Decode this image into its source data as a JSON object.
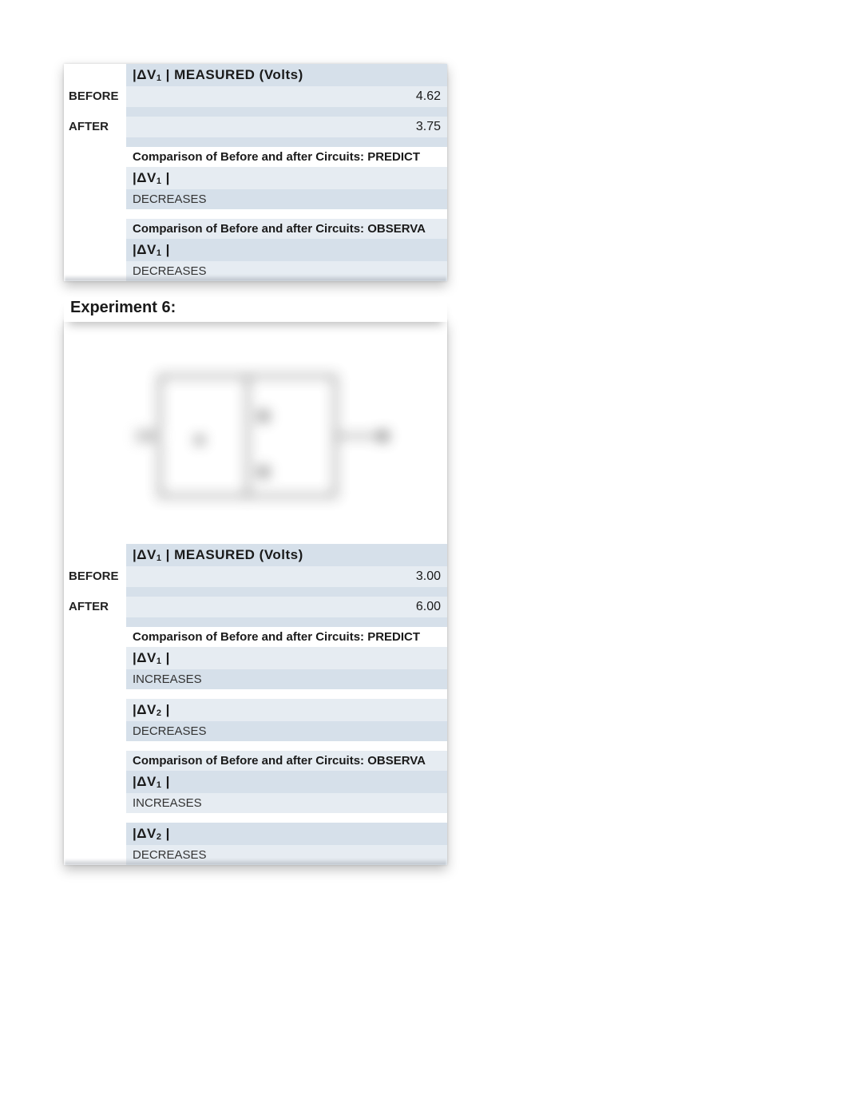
{
  "panel1": {
    "header": {
      "dv": "|ΔV",
      "sub": "1",
      "rest": " | MEASURED (Volts)"
    },
    "before_label": "BEFORE",
    "before_value": "4.62",
    "after_label": "AFTER",
    "after_value": "3.75",
    "predict_title": "Comparison of Before and after Circuits:  PREDICT",
    "predict_dv": "|ΔV",
    "predict_sub": "1",
    "predict_rest": " |",
    "predict_value": "DECREASES",
    "observa_title": "Comparison of Before and after Circuits:  OBSERVA",
    "observa_dv": "|ΔV",
    "observa_sub": "1",
    "observa_rest": " |",
    "observa_value": "DECREASES"
  },
  "experiment_title": "Experiment 6:",
  "panel2": {
    "header": {
      "dv": "|ΔV",
      "sub": "1",
      "rest": " | MEASURED (Volts)"
    },
    "before_label": "BEFORE",
    "before_value": "3.00",
    "after_label": "AFTER",
    "after_value": "6.00",
    "predict_title": "Comparison of Before and after Circuits:  PREDICT",
    "p_dv1": "|ΔV",
    "p_sub1": "1",
    "p_rest1": " |",
    "p_val1": "INCREASES",
    "p_dv2": "|ΔV",
    "p_sub2": "2",
    "p_rest2": " |",
    "p_val2": "DECREASES",
    "observa_title": "Comparison of Before and after Circuits:  OBSERVA",
    "o_dv1": "|ΔV",
    "o_sub1": "1",
    "o_rest1": " |",
    "o_val1": "INCREASES",
    "o_dv2": "|ΔV",
    "o_sub2": "2",
    "o_rest2": " |",
    "o_val2": "DECREASES"
  }
}
